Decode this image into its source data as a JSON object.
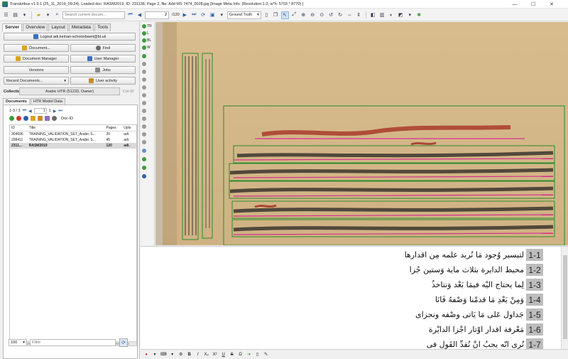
{
  "window": {
    "title": "Transkribus v1.9.1 (25_11_2019_09:24), Loaded doc: RASM2019, ID: 231138, Page 2, file: Add MS 7474_0028.jpg [Image Meta Info: (Resolution:1.0, w*h: 5703 * 8770) ]",
    "minimize": "—",
    "maximize": "☐",
    "close": "✕"
  },
  "toolbar": {
    "search_placeholder": "Search current docum...",
    "page_value": "2",
    "page_total": "/120",
    "version_select": "Ground Truth",
    "version_arrow": "▾"
  },
  "left": {
    "tabs": [
      "Server",
      "Overview",
      "Layout",
      "Metadata",
      "Tools"
    ],
    "logout_label": "Logout adi.keinan-schoonbaert@bl.uk",
    "document_label": "Document...",
    "find_label": "Find",
    "doc_manager_label": "Document Manager",
    "user_manager_label": "User Manager",
    "versions_label": "Versions",
    "jobs_label": "Jobs",
    "recent_label": "Recent Documents...",
    "user_activity_label": "User activity",
    "collections_label": "Collections:",
    "collection_value": "Arabic HTR (51233, Owner)",
    "colid_label": "Col-ID",
    "subtabs": [
      "Documents",
      "HTR Model Data"
    ],
    "pager_range": "1-3 / 3",
    "pager_page": "1",
    "pager_total": "1",
    "docid_label": "Doc-ID",
    "columns": [
      "ID",
      "Title",
      "Pages",
      "Uplo"
    ],
    "rows": [
      {
        "id": "304696",
        "title": "TRAINING_VALIDATION_SET_Arabic S...",
        "pages": "20",
        "up": "adi."
      },
      {
        "id": "298411",
        "title": "TRAINING_VALIDATION_SET_Arabic S...",
        "pages": "45",
        "up": "adi."
      },
      {
        "id": "2311...",
        "title": "RASM2019",
        "pages": "120",
        "up": "adi."
      }
    ],
    "page_size": "100",
    "page_size_arrow": "▾",
    "filter_placeholder": "Filter"
  },
  "vtools": [
    "TR",
    "L",
    "BL",
    "W"
  ],
  "transcript": {
    "lines": [
      {
        "num": "1-1",
        "text": "لتيسير وُجود مَا نُريد علمه مِن اقدارها"
      },
      {
        "num": "1-2",
        "text": "محيط الدايرة بثلاث ماية وَستين جُزا"
      },
      {
        "num": "1-3",
        "text": "لِما يحتاج اليْه فيمَا بَعْد وَنتاخذُ"
      },
      {
        "num": "1-4",
        "text": "وَمِنْ بَعْدِ مَا قدمْنا وَصْفهُ فَانَا"
      },
      {
        "num": "1-5",
        "text": "جَداول عَلى مَا يَاتى وصْفه ونجزاى"
      },
      {
        "num": "1-6",
        "text": "مَعْرفة اقدار اوْتار اجْزا الدايْرة"
      },
      {
        "num": "1-7",
        "text": "نُرى انّه يجبُ انْ نُقدِّ القَول فى"
      }
    ]
  },
  "format_bar": [
    "B",
    "I",
    "X₂",
    "X²",
    "U",
    "S"
  ],
  "colors": {
    "accent": "#2d5fa7",
    "green": "#3d9d3d",
    "parchment": "#d9c39a",
    "ink": "#1b1b1b",
    "rubric": "#a32a1f"
  }
}
